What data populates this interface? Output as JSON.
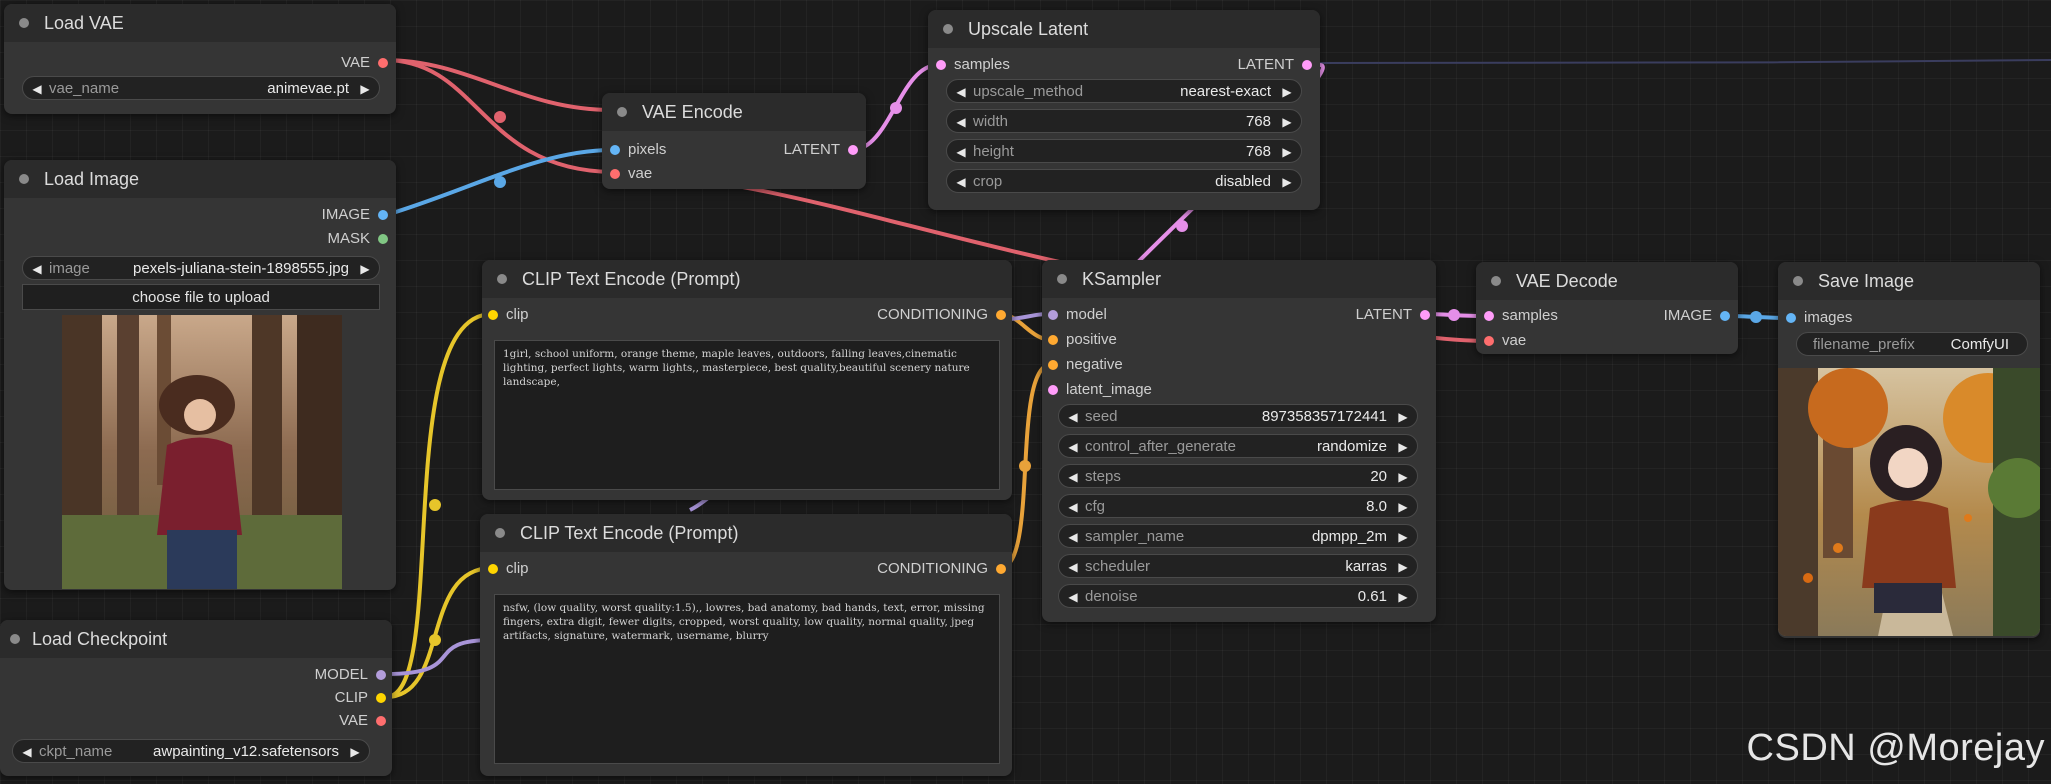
{
  "colors": {
    "canvas": "#1b1b1b",
    "node_body": "#353535",
    "node_title": "#2b2b2b",
    "slot_vae": "#ff6e6e",
    "slot_image": "#64b5f6",
    "slot_mask": "#81c784",
    "slot_latent": "#ff9cf9",
    "slot_conditioning": "#ffa931",
    "slot_model": "#b39ddb",
    "slot_clip": "#ffd500"
  },
  "nodes": {
    "load_vae": {
      "title": "Load VAE",
      "outputs": {
        "vae": "VAE"
      },
      "widgets": {
        "vae_name": {
          "name": "vae_name",
          "value": "animevae.pt"
        }
      }
    },
    "load_image": {
      "title": "Load Image",
      "outputs": {
        "image": "IMAGE",
        "mask": "MASK"
      },
      "widgets": {
        "image": {
          "name": "image",
          "value": "pexels-juliana-stein-1898555.jpg"
        }
      },
      "upload_label": "choose file to upload"
    },
    "load_checkpoint": {
      "title": "Load Checkpoint",
      "outputs": {
        "model": "MODEL",
        "clip": "CLIP",
        "vae": "VAE"
      },
      "widgets": {
        "ckpt_name": {
          "name": "ckpt_name",
          "value": "awpainting_v12.safetensors"
        }
      }
    },
    "vae_encode": {
      "title": "VAE Encode",
      "inputs": {
        "pixels": "pixels",
        "vae": "vae"
      },
      "outputs": {
        "latent": "LATENT"
      }
    },
    "upscale_latent": {
      "title": "Upscale Latent",
      "inputs": {
        "samples": "samples"
      },
      "outputs": {
        "latent": "LATENT"
      },
      "widgets": {
        "upscale_method": {
          "name": "upscale_method",
          "value": "nearest-exact"
        },
        "width": {
          "name": "width",
          "value": "768"
        },
        "height": {
          "name": "height",
          "value": "768"
        },
        "crop": {
          "name": "crop",
          "value": "disabled"
        }
      }
    },
    "clip_positive": {
      "title": "CLIP Text Encode (Prompt)",
      "inputs": {
        "clip": "clip"
      },
      "outputs": {
        "conditioning": "CONDITIONING"
      },
      "text": "1girl, school uniform, orange theme, maple leaves, outdoors, falling leaves,cinematic lighting, perfect lights, warm lights,, masterpiece, best quality,beautiful scenery nature landscape,"
    },
    "clip_negative": {
      "title": "CLIP Text Encode (Prompt)",
      "inputs": {
        "clip": "clip"
      },
      "outputs": {
        "conditioning": "CONDITIONING"
      },
      "text": "nsfw, (low quality, worst quality:1.5),, lowres, bad anatomy, bad hands, text, error, missing fingers, extra digit, fewer digits, cropped, worst quality, low quality, normal quality, jpeg artifacts, signature, watermark, username, blurry"
    },
    "ksampler": {
      "title": "KSampler",
      "inputs": {
        "model": "model",
        "positive": "positive",
        "negative": "negative",
        "latent_image": "latent_image"
      },
      "outputs": {
        "latent": "LATENT"
      },
      "widgets": {
        "seed": {
          "name": "seed",
          "value": "897358357172441"
        },
        "control_after_generate": {
          "name": "control_after_generate",
          "value": "randomize"
        },
        "steps": {
          "name": "steps",
          "value": "20"
        },
        "cfg": {
          "name": "cfg",
          "value": "8.0"
        },
        "sampler_name": {
          "name": "sampler_name",
          "value": "dpmpp_2m"
        },
        "scheduler": {
          "name": "scheduler",
          "value": "karras"
        },
        "denoise": {
          "name": "denoise",
          "value": "0.61"
        }
      }
    },
    "vae_decode": {
      "title": "VAE Decode",
      "inputs": {
        "samples": "samples",
        "vae": "vae"
      },
      "outputs": {
        "image": "IMAGE"
      }
    },
    "save_image": {
      "title": "Save Image",
      "inputs": {
        "images": "images"
      },
      "widgets": {
        "filename_prefix": {
          "name": "filename_prefix",
          "value": "ComfyUI"
        }
      }
    }
  },
  "watermark": "CSDN @Morejay"
}
